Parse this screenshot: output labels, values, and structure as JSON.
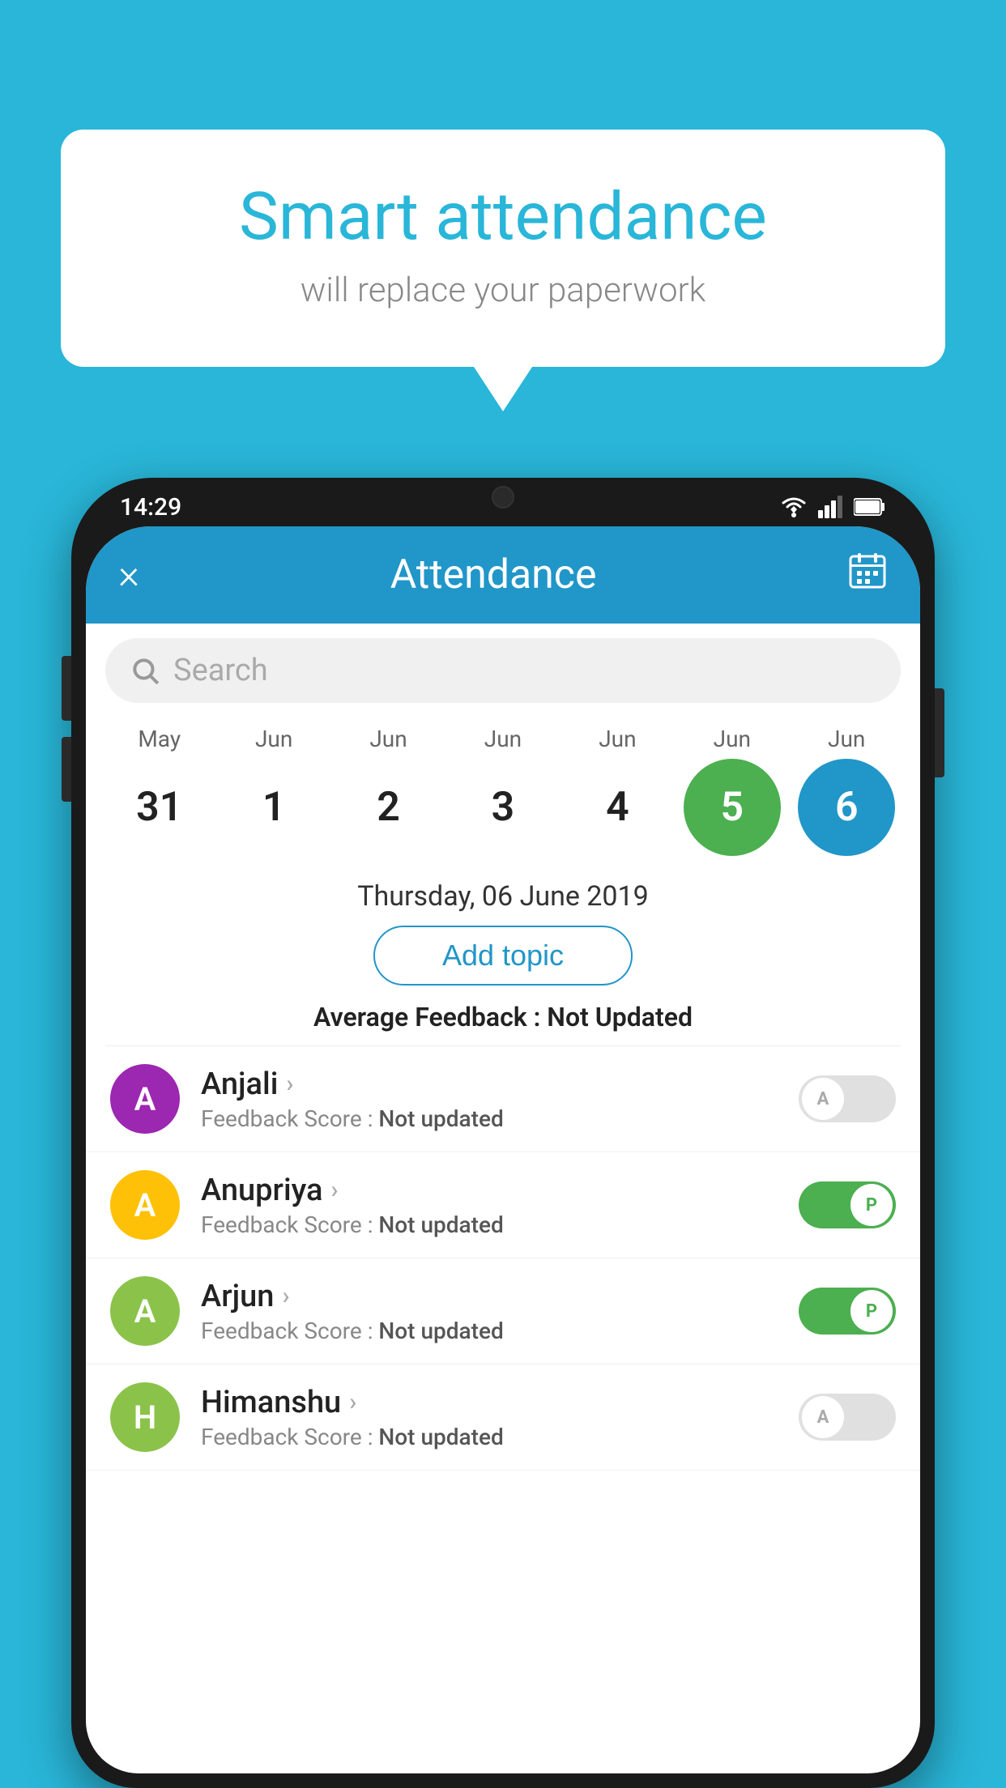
{
  "background_color": "#29b6d8",
  "bubble": {
    "title": "Smart attendance",
    "subtitle": "will replace your paperwork"
  },
  "status_bar": {
    "time": "14:29",
    "wifi": "▼",
    "signal": "▲",
    "battery": "▮"
  },
  "app_header": {
    "title": "Attendance",
    "close_label": "×",
    "calendar_label": "📅"
  },
  "search": {
    "placeholder": "Search"
  },
  "calendar": {
    "months": [
      "May",
      "Jun",
      "Jun",
      "Jun",
      "Jun",
      "Jun",
      "Jun"
    ],
    "dates": [
      "31",
      "1",
      "2",
      "3",
      "4",
      "5",
      "6"
    ],
    "today_index": 5,
    "selected_index": 6
  },
  "selected_date": "Thursday, 06 June 2019",
  "add_topic_label": "Add topic",
  "avg_feedback_label": "Average Feedback :",
  "avg_feedback_value": "Not Updated",
  "students": [
    {
      "name": "Anjali",
      "avatar_letter": "A",
      "avatar_color": "#9c27b0",
      "score_label": "Feedback Score :",
      "score_value": "Not updated",
      "attendance": "absent"
    },
    {
      "name": "Anupriya",
      "avatar_letter": "A",
      "avatar_color": "#ffc107",
      "score_label": "Feedback Score :",
      "score_value": "Not updated",
      "attendance": "present"
    },
    {
      "name": "Arjun",
      "avatar_letter": "A",
      "avatar_color": "#8bc34a",
      "score_label": "Feedback Score :",
      "score_value": "Not updated",
      "attendance": "present"
    },
    {
      "name": "Himanshu",
      "avatar_letter": "H",
      "avatar_color": "#8bc34a",
      "score_label": "Feedback Score :",
      "score_value": "Not updated",
      "attendance": "absent"
    }
  ],
  "toggle_absent_label": "A",
  "toggle_present_label": "P"
}
